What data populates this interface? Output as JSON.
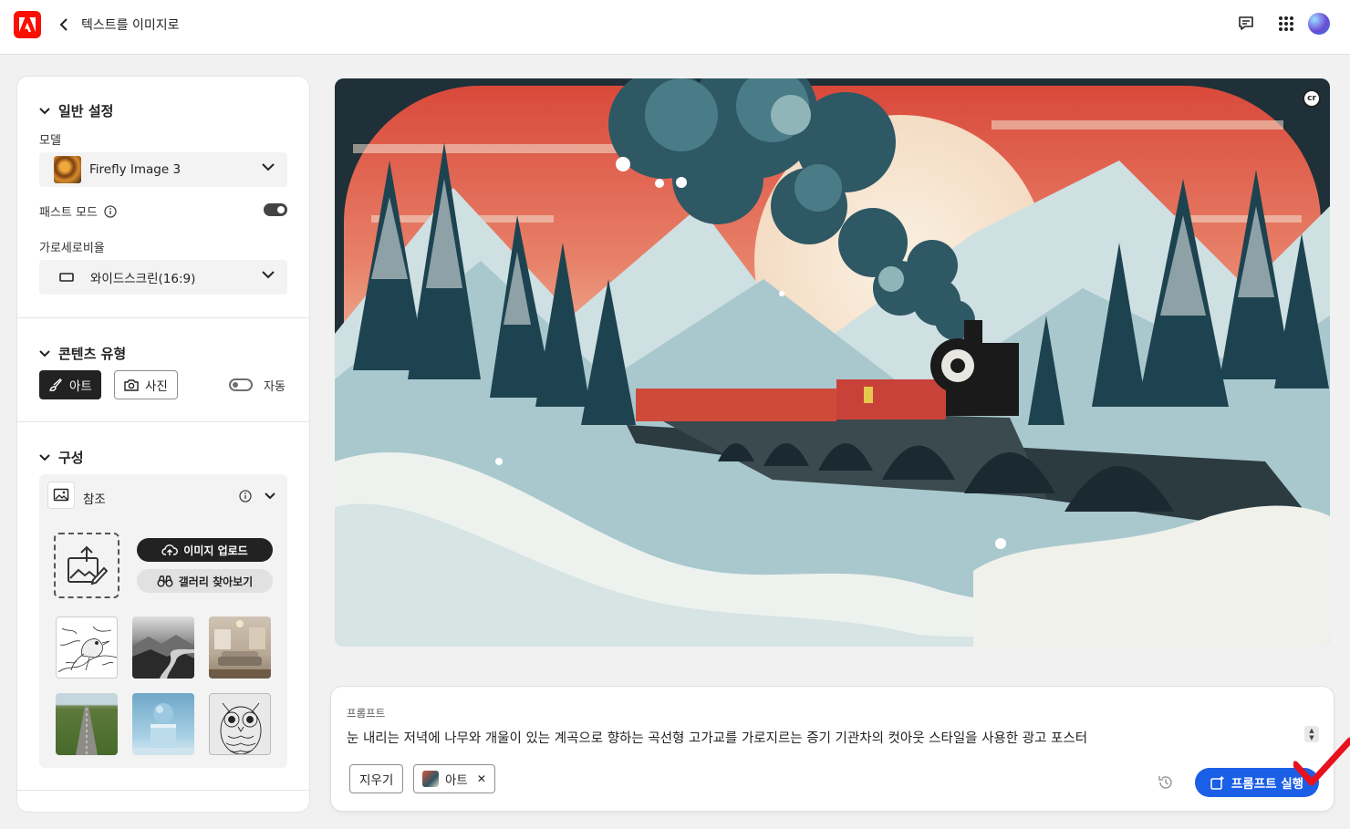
{
  "header": {
    "title": "텍스트를 이미지로",
    "icons": [
      "adobe-logo",
      "chevron-left-icon",
      "comment-icon",
      "apps-grid-icon",
      "avatar"
    ]
  },
  "general": {
    "heading": "일반 설정",
    "model_label": "모델",
    "model_value": "Firefly Image 3",
    "fast_mode_label": "패스트 모드",
    "fast_mode_on": true,
    "aspect_label": "가로세로비율",
    "aspect_value": "와이드스크린(16:9)"
  },
  "content_type": {
    "heading": "콘텐츠 유형",
    "art_label": "아트",
    "photo_label": "사진",
    "auto_label": "자동",
    "selected": "아트",
    "auto_on": false
  },
  "composition": {
    "heading": "구성",
    "reference_label": "참조",
    "upload_label": "이미지 업로드",
    "gallery_label": "갤러리 찾아보기",
    "thumbnails": [
      "bird-sketch",
      "misty-river",
      "living-room",
      "road-field",
      "sphere-pedestal",
      "owl-sketch"
    ]
  },
  "prompt": {
    "label": "프롬프트",
    "text": "눈 내리는 저녁에 나무와 개울이 있는 계곡으로 향하는 곡선형 고가교를 가로지르는 증기 기관차의 컷아웃 스타일을 사용한 광고 포스터",
    "clear_label": "지우기",
    "tag_label": "아트",
    "generate_label": "프롬프트 실행"
  },
  "hero": {
    "badge": "cr"
  },
  "colors": {
    "adobe_red": "#fa0f00",
    "accent_blue": "#1b5fe6",
    "check_red": "#e8121f"
  }
}
